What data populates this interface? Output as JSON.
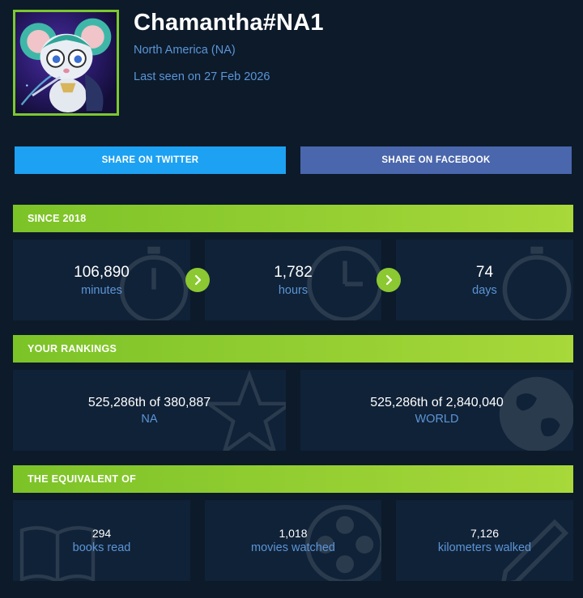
{
  "profile": {
    "summoner_name": "Chamantha#NA1",
    "region": "North America (NA)",
    "last_seen": "Last seen on 27 Feb 2026"
  },
  "share": {
    "twitter_label": "SHARE ON TWITTER",
    "facebook_label": "SHARE ON FACEBOOK",
    "twitter_color": "#1da1f2",
    "facebook_color": "#4a66ac"
  },
  "since": {
    "header": "SINCE 2018",
    "stats": [
      {
        "value": "106,890",
        "label": "minutes",
        "icon": "stopwatch-icon"
      },
      {
        "value": "1,782",
        "label": "hours",
        "icon": "clock-icon"
      },
      {
        "value": "74",
        "label": "days",
        "icon": "stopwatch-icon"
      }
    ]
  },
  "rankings": {
    "header": "YOUR RANKINGS",
    "items": [
      {
        "value": "525,286th of 380,887",
        "label": "NA",
        "icon": "star-icon"
      },
      {
        "value": "525,286th of 2,840,040",
        "label": "WORLD",
        "icon": "globe-icon"
      }
    ]
  },
  "equivalent": {
    "header": "THE EQUIVALENT OF",
    "items": [
      {
        "value": "294",
        "label": "books read",
        "icon": "book-icon"
      },
      {
        "value": "1,018",
        "label": "movies watched",
        "icon": "film-reel-icon"
      },
      {
        "value": "7,126",
        "label": "kilometers walked",
        "icon": "pencil-icon"
      }
    ]
  },
  "colors": {
    "background": "#0c1a2a",
    "card": "#102238",
    "accent_green": "#8cc832",
    "label_blue": "#5b95d6"
  }
}
